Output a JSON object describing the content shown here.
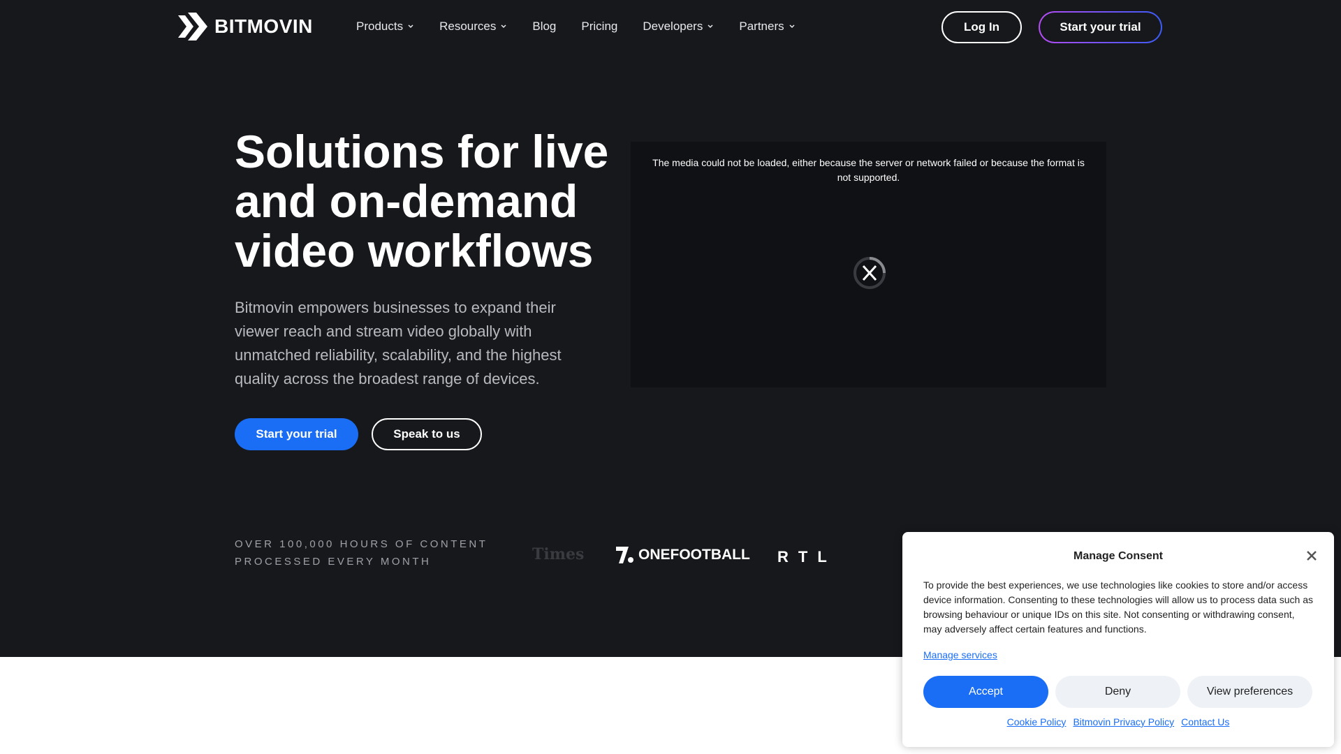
{
  "brand": {
    "name": "BITMOVIN"
  },
  "nav": {
    "items": [
      {
        "label": "Products",
        "has_menu": true
      },
      {
        "label": "Resources",
        "has_menu": true
      },
      {
        "label": "Blog",
        "has_menu": false
      },
      {
        "label": "Pricing",
        "has_menu": false
      },
      {
        "label": "Developers",
        "has_menu": true
      },
      {
        "label": "Partners",
        "has_menu": true
      }
    ],
    "login_label": "Log In",
    "trial_label": "Start your trial"
  },
  "hero": {
    "title": "Solutions for live and on-demand video workflows",
    "description": "Bitmovin empowers businesses to expand their viewer reach and stream video globally with unmatched reliability, scalability, and the highest quality across the broadest range of devices.",
    "primary_cta": "Start your trial",
    "secondary_cta": "Speak to us"
  },
  "video": {
    "error_message": "The media could not be loaded, either because the server or network failed or because the format is not supported.",
    "icon": "error-x-icon"
  },
  "stats": {
    "line1": "OVER 100,000 HOURS OF CONTENT",
    "line2": "PROCESSED EVERY MONTH"
  },
  "customer_logos": {
    "times": "Times",
    "onefootball": "ONEFOOTBALL",
    "rtl": "RTL"
  },
  "consent": {
    "title": "Manage Consent",
    "body": "To provide the best experiences, we use technologies like cookies to store and/or access device information. Consenting to these technologies will allow us to process data such as browsing behaviour or unique IDs on this site. Not consenting or withdrawing consent, may adversely affect certain features and functions.",
    "manage_services": "Manage services",
    "accept_label": "Accept",
    "deny_label": "Deny",
    "view_preferences_label": "View preferences",
    "links": [
      "Cookie Policy",
      "Bitmovin Privacy Policy",
      "Contact Us"
    ]
  },
  "colors": {
    "background_dark": "#17181c",
    "accent_blue": "#1a6ef5",
    "gradient_start": "#b44cf2",
    "gradient_end": "#3b5bf6"
  }
}
